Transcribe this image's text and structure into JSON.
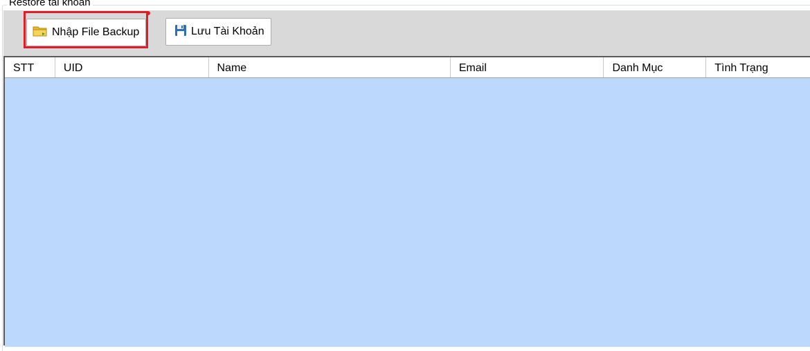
{
  "group": {
    "title": "Restore tài khoản"
  },
  "toolbar": {
    "import_label": "Nhập File Backup",
    "save_label": "Lưu Tài Khoản",
    "import_icon": "folder-icon",
    "save_icon": "floppy-disk-icon"
  },
  "table": {
    "columns": [
      "STT",
      "UID",
      "Name",
      "Email",
      "Danh Mục",
      "Tình Trạng"
    ],
    "rows": []
  },
  "colors": {
    "highlight": "#e01e2a",
    "grid_background": "#bcd8fd",
    "toolbar_background": "#d9d9d9"
  }
}
